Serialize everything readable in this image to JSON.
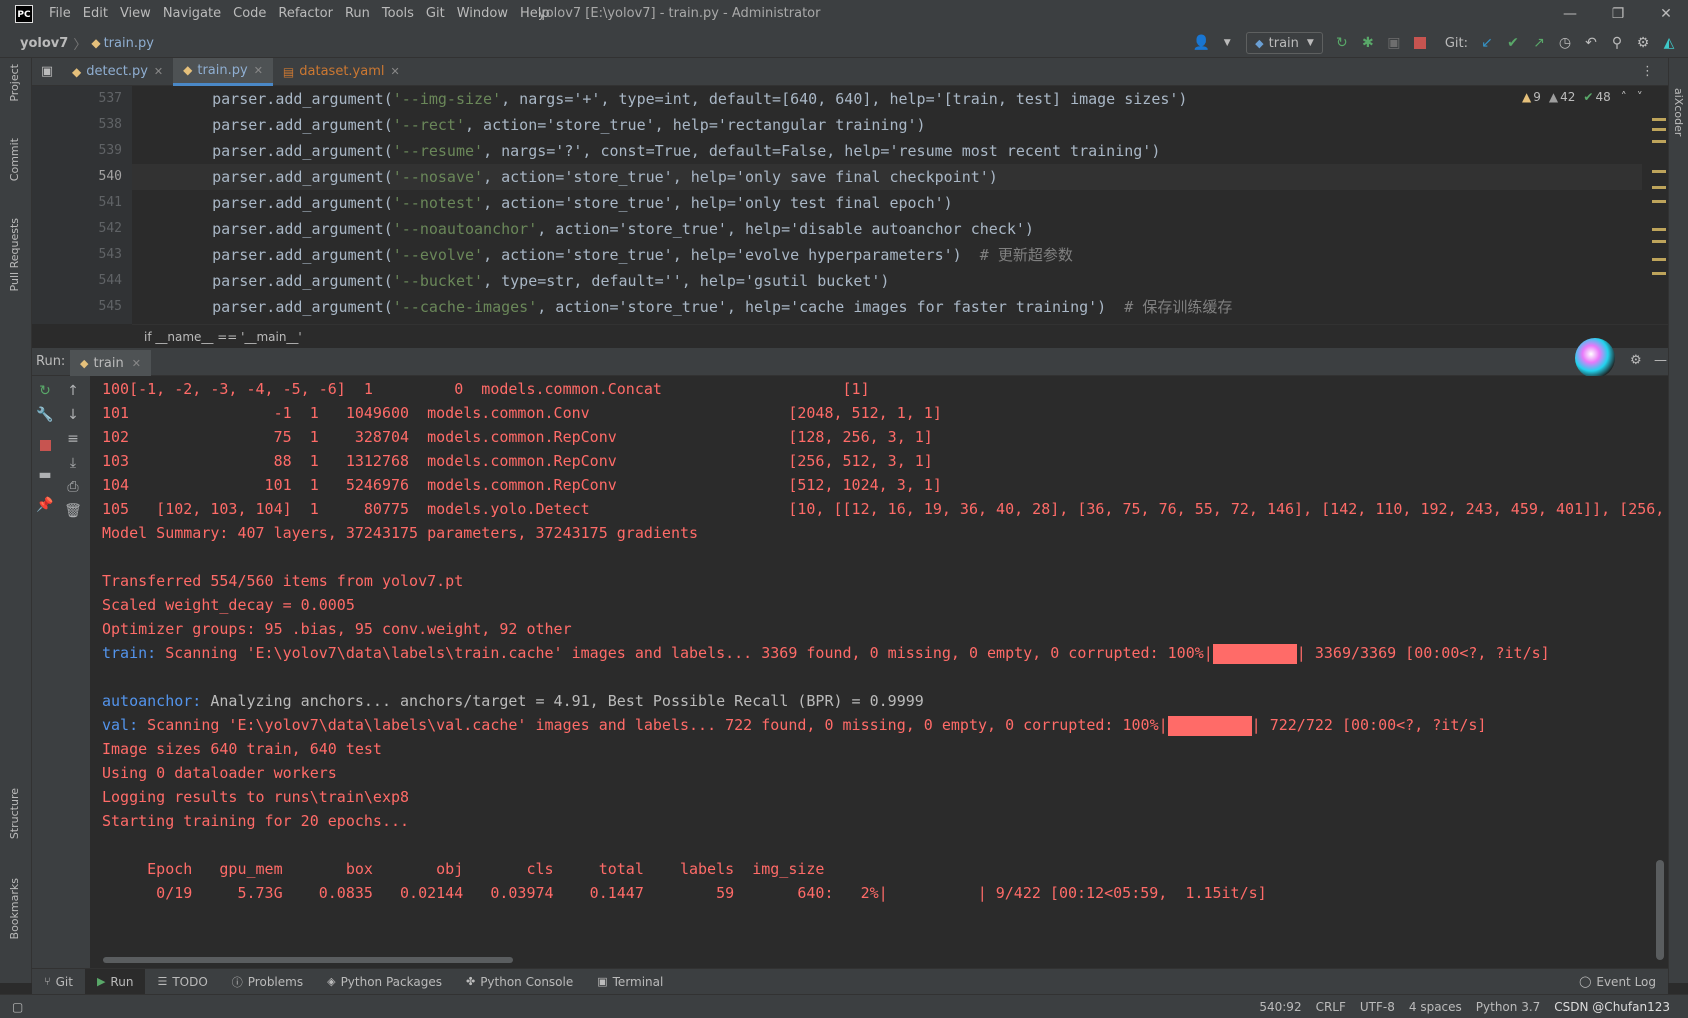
{
  "window": {
    "logo": "PC",
    "menu": [
      "File",
      "Edit",
      "View",
      "Navigate",
      "Code",
      "Refactor",
      "Run",
      "Tools",
      "Git",
      "Window",
      "Help"
    ],
    "title": "yolov7 [E:\\yolov7] - train.py - Administrator",
    "controls": {
      "minimize": "—",
      "restore": "❐",
      "close": "✕"
    }
  },
  "navbar": {
    "project": "yolov7",
    "file": "train.py",
    "run_config": "train",
    "git_label": "Git:"
  },
  "left_strip": {
    "project": "Project",
    "commit": "Commit",
    "pull_requests": "Pull Requests",
    "structure": "Structure",
    "bookmarks": "Bookmarks"
  },
  "right_strip": {
    "aixcoder": "aiXcoder"
  },
  "editor_tabs": [
    {
      "label": "detect.py",
      "active": false
    },
    {
      "label": "train.py",
      "active": true
    },
    {
      "label": "dataset.yaml",
      "active": false
    }
  ],
  "inspections": {
    "warnings": "9",
    "weak": "42",
    "ok": "48"
  },
  "code": {
    "line_numbers": [
      "537",
      "538",
      "539",
      "540",
      "541",
      "542",
      "543",
      "544",
      "545"
    ],
    "lines": [
      {
        "a": "    parser.add_argument(",
        "s": "'--img-size'",
        "rest": ", nargs='+', type=int, default=[640, 640], help='[train, test] image sizes')",
        "c": ""
      },
      {
        "a": "    parser.add_argument(",
        "s": "'--rect'",
        "rest": ", action='store_true', help='rectangular training')",
        "c": ""
      },
      {
        "a": "    parser.add_argument(",
        "s": "'--resume'",
        "rest": ", nargs='?', const=True, default=False, help='resume most recent training')",
        "c": ""
      },
      {
        "a": "    parser.add_argument(",
        "s": "'--nosave'",
        "rest": ", action='store_true', help='only save final checkpoint')",
        "c": ""
      },
      {
        "a": "    parser.add_argument(",
        "s": "'--notest'",
        "rest": ", action='store_true', help='only test final epoch')",
        "c": ""
      },
      {
        "a": "    parser.add_argument(",
        "s": "'--noautoanchor'",
        "rest": ", action='store_true', help='disable autoanchor check')",
        "c": ""
      },
      {
        "a": "    parser.add_argument(",
        "s": "'--evolve'",
        "rest": ", action='store_true', help='evolve hyperparameters')",
        "c": "  # 更新超参数"
      },
      {
        "a": "    parser.add_argument(",
        "s": "'--bucket'",
        "rest": ", type=str, default='', help='gsutil bucket')",
        "c": ""
      },
      {
        "a": "    parser.add_argument(",
        "s": "'--cache-images'",
        "rest": ", action='store_true', help='cache images for faster training')",
        "c": "  # 保存训练缓存"
      }
    ],
    "breadcrumb": "if __name__ == '__main__'"
  },
  "run": {
    "label": "Run:",
    "tab": "train",
    "console": [
      "100[-1, -2, -3, -4, -5, -6]  1         0  models.common.Concat                    [1]",
      "101                -1  1   1049600  models.common.Conv                      [2048, 512, 1, 1]",
      "102                75  1    328704  models.common.RepConv                   [128, 256, 3, 1]",
      "103                88  1   1312768  models.common.RepConv                   [256, 512, 3, 1]",
      "104               101  1   5246976  models.common.RepConv                   [512, 1024, 3, 1]",
      "105   [102, 103, 104]  1     80775  models.yolo.Detect                      [10, [[12, 16, 19, 36, 40, 28], [36, 75, 76, 55, 72, 146], [142, 110, 192, 243, 459, 401]], [256,",
      "Model Summary: 407 layers, 37243175 parameters, 37243175 gradients",
      "",
      "Transferred 554/560 items from yolov7.pt",
      "Scaled weight_decay = 0.0005",
      "Optimizer groups: 95 .bias, 95 conv.weight, 92 other"
    ],
    "train_scan": {
      "prefix": "train:",
      "text": " Scanning 'E:\\yolov7\\data\\labels\\train.cache' images and labels... 3369 found, 0 missing, 0 empty, 0 corrupted: 100%|",
      "progress": 1.0,
      "suffix": "| 3369/3369 [00:00<?, ?it/s]"
    },
    "autoanchor": {
      "prefix": "autoanchor:",
      "text": " Analyzing anchors... anchors/target = 4.91, Best Possible Recall (BPR) = 0.9999"
    },
    "val_scan": {
      "prefix": "val:",
      "text": " Scanning 'E:\\yolov7\\data\\labels\\val.cache' images and labels... 722 found, 0 missing, 0 empty, 0 corrupted: 100%|",
      "progress": 1.0,
      "suffix": "| 722/722 [00:00<?, ?it/s]"
    },
    "console2": [
      "Image sizes 640 train, 640 test",
      "Using 0 dataloader workers",
      "Logging results to runs\\train\\exp8",
      "Starting training for 20 epochs..."
    ],
    "epoch_header": "     Epoch   gpu_mem       box       obj       cls     total    labels  img_size",
    "epoch_row": "      0/19     5.73G    0.0835   0.02144   0.03974    0.1447        59       640:   2%|",
    "epoch_progress": 0.02,
    "epoch_suffix": "| 9/422 [00:12<05:59,  1.15it/s]"
  },
  "bottom_tabs": [
    "Git",
    "Run",
    "TODO",
    "Problems",
    "Python Packages",
    "Python Console",
    "Terminal"
  ],
  "event_log": "Event Log",
  "status": {
    "position": "540:92",
    "line_sep": "CRLF",
    "encoding": "UTF-8",
    "indent": "4 spaces",
    "interpreter": "Python 3.7",
    "watermark": "CSDN @Chufan123"
  }
}
